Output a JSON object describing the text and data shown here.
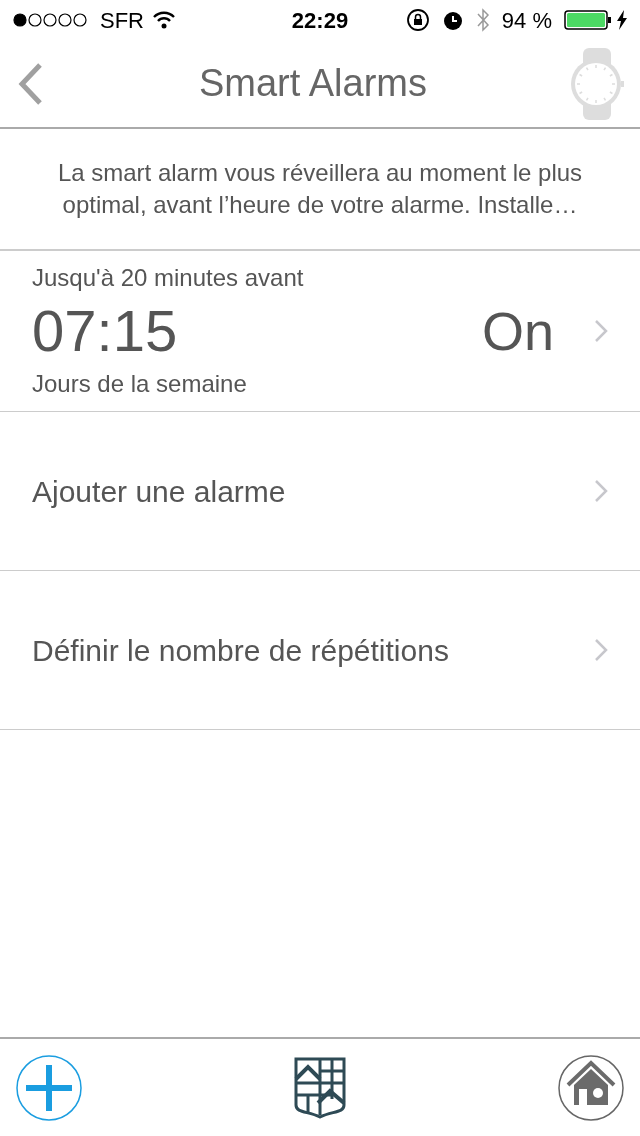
{
  "status_bar": {
    "carrier": "SFR",
    "time": "22:29",
    "battery": "94 %"
  },
  "nav": {
    "title": "Smart Alarms"
  },
  "description": "La smart alarm vous réveillera au moment le plus optimal, avant l’heure de votre alarme. Installe…",
  "alarms": [
    {
      "window": "Jusqu'à 20 minutes avant",
      "time": "07:15",
      "status": "On",
      "days": "Jours de la semaine"
    }
  ],
  "actions": [
    {
      "label": "Ajouter une alarme"
    },
    {
      "label": "Définir le nombre de répétitions"
    }
  ]
}
